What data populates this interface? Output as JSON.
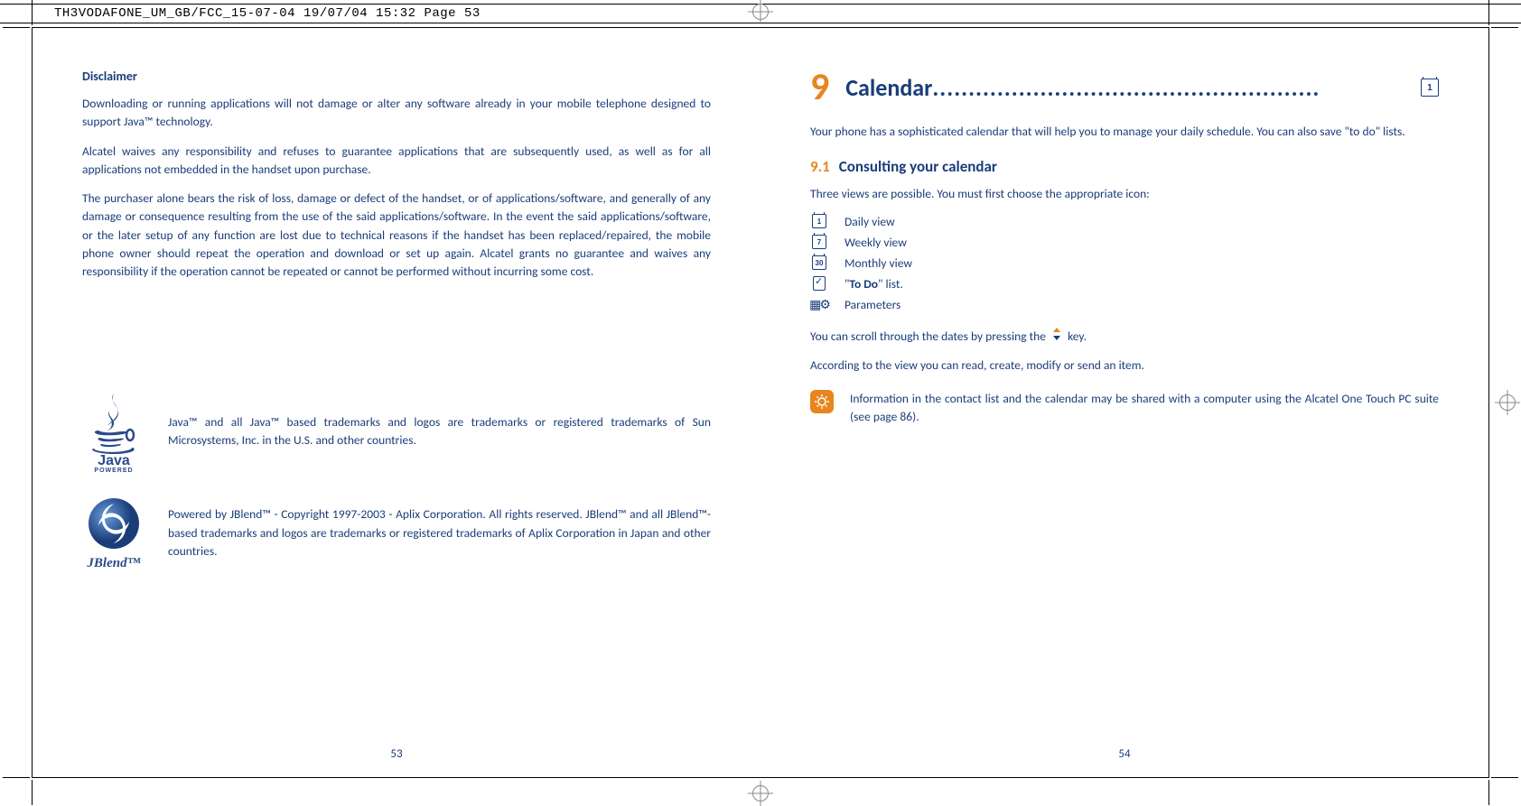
{
  "header_bar": "TH3VODAFONE_UM_GB/FCC_15-07-04  19/07/04  15:32  Page 53",
  "left": {
    "disclaimer_heading": "Disclaimer",
    "p1": "Downloading or running applications will not damage or alter any software already in your mobile telephone designed to support Java™ technology.",
    "p2": "Alcatel waives any responsibility and refuses to guarantee applications that are subsequently used, as well as for all applications not embedded in the handset upon purchase.",
    "p3": "The purchaser alone bears the risk of loss, damage or defect of the handset, or of applications/software, and generally of any damage or consequence resulting from the use of the said applications/software. In the event the said applications/software, or the later setup of any function are lost due to technical reasons if the handset has been replaced/repaired, the mobile phone owner should repeat the operation and download or set up again. Alcatel grants no guarantee and waives any responsibility if the operation cannot be repeated or cannot be performed without incurring some cost.",
    "java_text": "Java™ and all Java™ based trademarks and logos are trademarks or registered trademarks of Sun Microsystems, Inc. in the U.S. and other countries.",
    "jblend_text": "Powered by JBlend™ - Copyright 1997-2003 - Aplix Corporation. All rights reserved. JBlend™ and all JBlend™-based trademarks and logos are trademarks or registered trademarks of Aplix Corporation in Japan and other countries.",
    "page_num": "53"
  },
  "right": {
    "chapter_num": "9",
    "chapter_title": "Calendar",
    "chapter_dots": "......................................................",
    "intro": "Your phone has a sophisticated calendar that will help you to manage your daily schedule. You can also save \"to do\" lists.",
    "section_num": "9.1",
    "section_title": "Consulting your calendar",
    "section_intro": "Three views are possible. You must first choose the appropriate icon:",
    "views": {
      "daily": "Daily view",
      "weekly": "Weekly view",
      "monthly": "Monthly view",
      "todo_prefix": "\"",
      "todo_bold": "To Do",
      "todo_suffix": "\" list.",
      "params": "Parameters"
    },
    "scroll_prefix": "You can scroll through the dates by pressing the ",
    "scroll_suffix": " key.",
    "according": "According to the view you can read, create, modify or send an item.",
    "info_text": "Information in the contact list and the calendar may be shared with a computer using the Alcatel One Touch PC suite (see page 86).",
    "page_num": "54",
    "cal_icons": {
      "daily": "1",
      "weekly": "7",
      "monthly": "30"
    }
  }
}
